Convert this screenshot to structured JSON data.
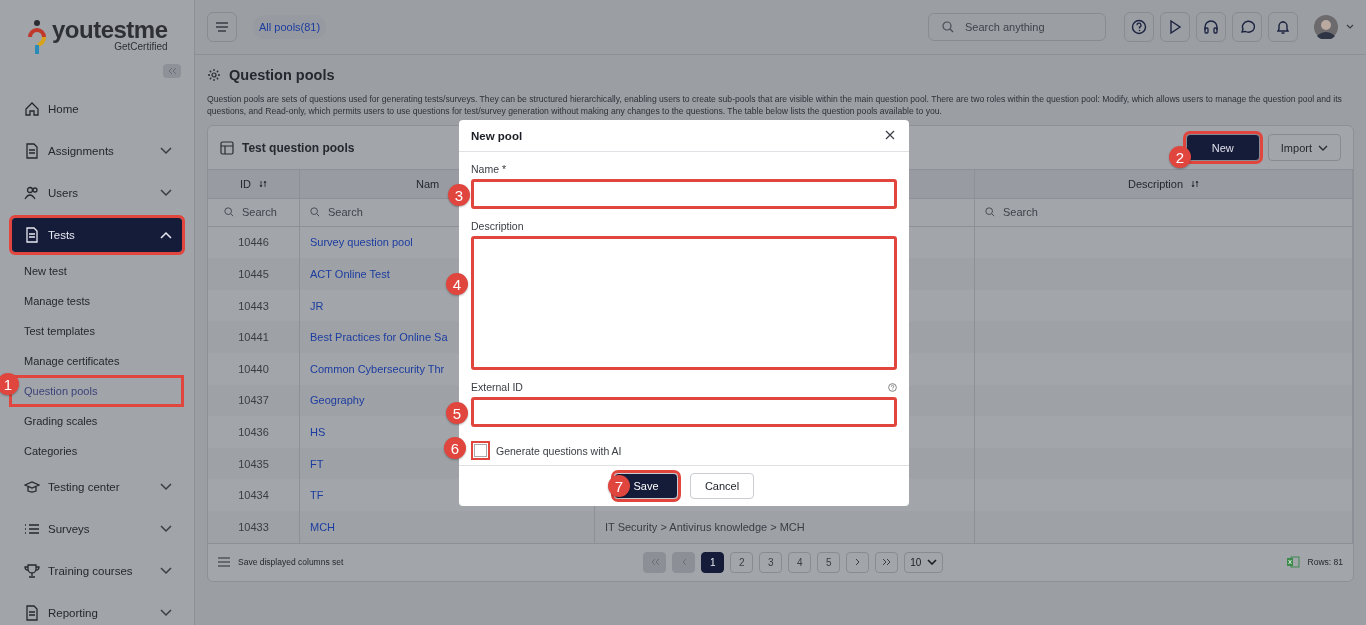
{
  "logo": {
    "name": "youtestme",
    "tagline": "GetCertified"
  },
  "sidebar": {
    "items": [
      {
        "label": "Home",
        "expandable": false,
        "selected": false,
        "highlighted": false
      },
      {
        "label": "Assignments",
        "expandable": true,
        "expanded": false,
        "selected": false,
        "highlighted": false
      },
      {
        "label": "Users",
        "expandable": true,
        "expanded": false,
        "selected": false,
        "highlighted": false
      },
      {
        "label": "Tests",
        "expandable": true,
        "expanded": true,
        "selected": true,
        "highlighted": true,
        "children": [
          {
            "label": "New test",
            "selected": false,
            "highlighted": false
          },
          {
            "label": "Manage tests",
            "selected": false,
            "highlighted": false
          },
          {
            "label": "Test templates",
            "selected": false,
            "highlighted": false
          },
          {
            "label": "Manage certificates",
            "selected": false,
            "highlighted": false
          },
          {
            "label": "Question pools",
            "selected": true,
            "highlighted": true
          },
          {
            "label": "Grading scales",
            "selected": false,
            "highlighted": false
          },
          {
            "label": "Categories",
            "selected": false,
            "highlighted": false
          }
        ]
      },
      {
        "label": "Testing center",
        "expandable": true,
        "expanded": false,
        "selected": false,
        "highlighted": false
      },
      {
        "label": "Surveys",
        "expandable": true,
        "expanded": false,
        "selected": false,
        "highlighted": false
      },
      {
        "label": "Training courses",
        "expandable": true,
        "expanded": false,
        "selected": false,
        "highlighted": false
      },
      {
        "label": "Reporting",
        "expandable": true,
        "expanded": false,
        "selected": false,
        "highlighted": false
      }
    ]
  },
  "topbar": {
    "breadcrumb": "All pools(81)",
    "search": {
      "placeholder": "Search anything"
    }
  },
  "page": {
    "title": "Question pools",
    "description": "Question pools are sets of questions used for generating tests/surveys. They can be structured hierarchically, enabling users to create sub-pools that are visible within the main question pool. There are two roles within the question pool: Modify, which allows users to manage the question pool and its questions, and Read-only, which permits users to use questions for test/survey generation without making any changes to the questions. The table below lists the question pools available to you."
  },
  "table": {
    "title": "Test question pools",
    "buttons": [
      {
        "label": "New",
        "kind": "primary",
        "highlighted": true
      },
      {
        "label": "Import",
        "kind": "dropdown",
        "highlighted": false
      }
    ],
    "columns": [
      {
        "label": "ID",
        "sortable": true,
        "filter_placeholder": "Search"
      },
      {
        "label": "Nam",
        "sortable": false,
        "filter_placeholder": "Search"
      },
      {
        "label": "Description",
        "sortable": true,
        "filter_placeholder": "Search"
      }
    ],
    "rows": [
      {
        "id": "10446",
        "name": "Survey question pool"
      },
      {
        "id": "10445",
        "name": "ACT Online Test"
      },
      {
        "id": "10443",
        "name": "JR"
      },
      {
        "id": "10441",
        "name": "Best Practices for Online Sa"
      },
      {
        "id": "10440",
        "name": "Common Cybersecurity Thr"
      },
      {
        "id": "10437",
        "name": "Geography"
      },
      {
        "id": "10436",
        "name": "HS"
      },
      {
        "id": "10435",
        "name": "FT"
      },
      {
        "id": "10434",
        "name": "TF"
      },
      {
        "id": "10433",
        "name": "MCH",
        "column_3": "IT Security > Antivirus knowledge > MCH"
      }
    ],
    "footer": {
      "columns_action": "Save displayed columns set",
      "pages": [
        {
          "label": "1",
          "selected": true
        },
        {
          "label": "2",
          "selected": false
        },
        {
          "label": "3",
          "selected": false
        },
        {
          "label": "4",
          "selected": false
        },
        {
          "label": "5",
          "selected": false
        }
      ],
      "page_size": "10",
      "rows_count": "Rows: 81"
    }
  },
  "modal": {
    "title": "New pool",
    "fields": [
      {
        "kind": "text",
        "label": "Name *",
        "highlighted": true
      },
      {
        "kind": "textarea",
        "label": "Description",
        "highlighted": true
      },
      {
        "kind": "text",
        "label": "External ID",
        "help": true,
        "highlighted": true
      },
      {
        "kind": "checkbox",
        "label": "Generate questions with AI",
        "checked": false,
        "highlighted": true
      }
    ],
    "buttons": [
      {
        "label": "Save",
        "kind": "primary",
        "highlighted": true
      },
      {
        "label": "Cancel",
        "kind": "secondary",
        "highlighted": false
      }
    ]
  },
  "callouts": [
    {
      "label": "1"
    },
    {
      "label": "2"
    },
    {
      "label": "3"
    },
    {
      "label": "4"
    },
    {
      "label": "5"
    },
    {
      "label": "6"
    },
    {
      "label": "7"
    }
  ]
}
